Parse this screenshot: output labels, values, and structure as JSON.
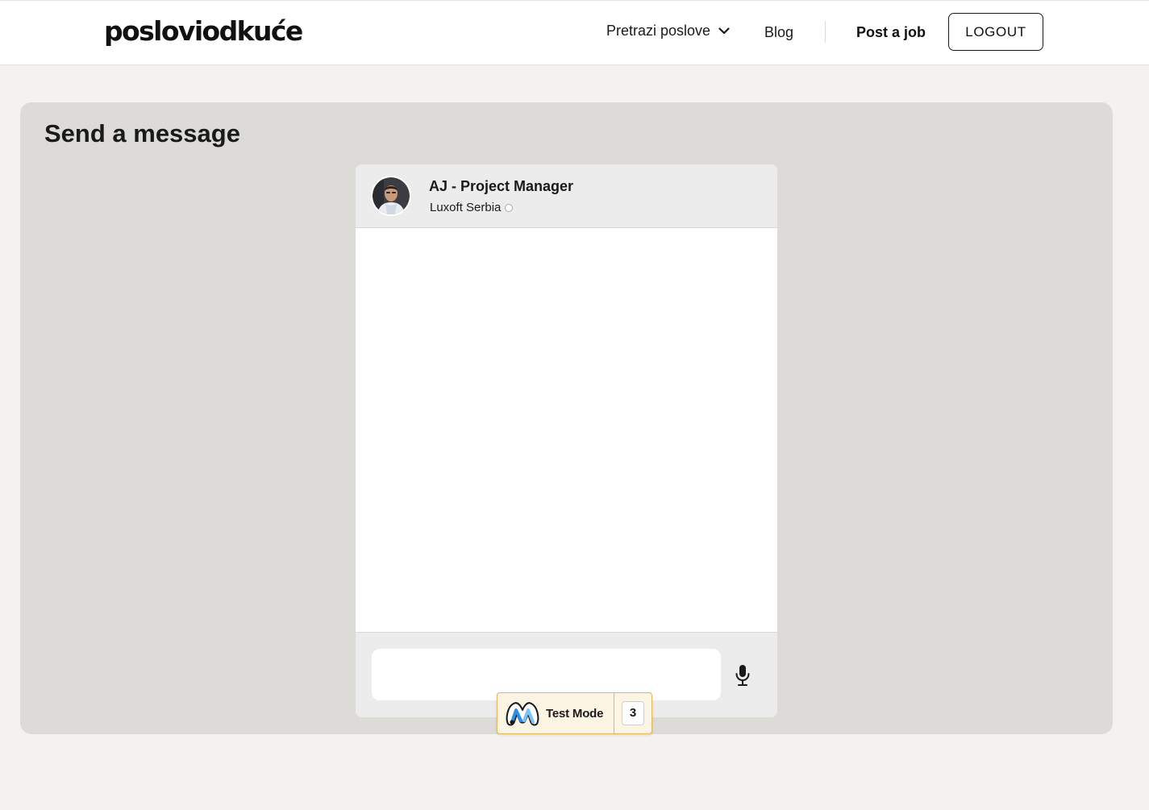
{
  "header": {
    "logo_text": "posloviodkuće",
    "nav": {
      "search_jobs_label": "Pretrazi poslove",
      "blog_label": "Blog",
      "post_job_label": "Post a job",
      "logout_label": "LOGOUT"
    }
  },
  "page": {
    "title": "Send a message"
  },
  "chat": {
    "contact": {
      "name": "AJ - Project Manager",
      "company": "Luxoft Serbia",
      "online": false
    },
    "input": {
      "value": "",
      "placeholder": ""
    },
    "mic_icon": "microphone-icon"
  },
  "test_badge": {
    "label": "Test Mode",
    "count": "3"
  },
  "colors": {
    "page_background": "#f3f2ef",
    "panel_background": "#dcdbd8",
    "chat_header_background": "#ececec",
    "badge_background": "#fdf5e3",
    "badge_border": "#e6b65a",
    "badge_logo_blue": "#2f8fe5"
  }
}
